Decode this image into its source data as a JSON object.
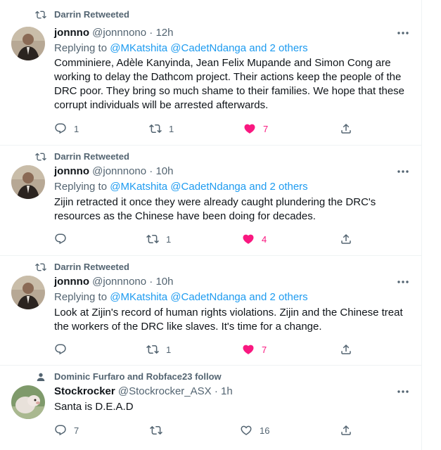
{
  "colors": {
    "accent": "#1d9bf0",
    "like": "#f91880",
    "muted": "#536471",
    "text": "#0f1419"
  },
  "tweets": [
    {
      "social_context": "Darrin Retweeted",
      "social_icon": "retweet-icon",
      "author_name": "jonnno",
      "author_handle": "@jonnnono",
      "dot": "·",
      "time": "12h",
      "replying_prefix": "Replying to",
      "replying_mentions": "@MKatshita @CadetNdanga and 2 others",
      "text": "Comminiere, Adèle Kanyinda, Jean Felix Mupande and Simon Cong are\nworking to delay the Dathcom project. Their actions keep the people of the\nDRC poor. They bring so much shame to their families. We hope that these\ncorrupt individuals will be arrested afterwards.",
      "replies": "1",
      "retweets": "1",
      "likes": "7",
      "liked": true
    },
    {
      "social_context": "Darrin Retweeted",
      "social_icon": "retweet-icon",
      "author_name": "jonnno",
      "author_handle": "@jonnnono",
      "dot": "·",
      "time": "10h",
      "replying_prefix": "Replying to",
      "replying_mentions": "@MKatshita @CadetNdanga and 2 others",
      "text": "Zijin retracted it once they were already caught plundering the DRC's\nresources as the Chinese have been doing for decades.",
      "replies": "",
      "retweets": "1",
      "likes": "4",
      "liked": true
    },
    {
      "social_context": "Darrin Retweeted",
      "social_icon": "retweet-icon",
      "author_name": "jonnno",
      "author_handle": "@jonnnono",
      "dot": "·",
      "time": "10h",
      "replying_prefix": "Replying to",
      "replying_mentions": "@MKatshita @CadetNdanga and 2 others",
      "text": "Look at Zijin's record of human rights violations. Zijin and the Chinese treat\nthe workers of the DRC like slaves. It's time for a change.",
      "replies": "",
      "retweets": "1",
      "likes": "7",
      "liked": true
    },
    {
      "social_context": "Dominic Furfaro and Robface23 follow",
      "social_icon": "person-icon",
      "author_name": "Stockrocker",
      "author_handle": "@Stockrocker_ASX",
      "dot": "·",
      "time": "1h",
      "replying_prefix": "",
      "replying_mentions": "",
      "text": "Santa is D.E.A.D",
      "replies": "7",
      "retweets": "",
      "likes": "16",
      "liked": false
    }
  ]
}
